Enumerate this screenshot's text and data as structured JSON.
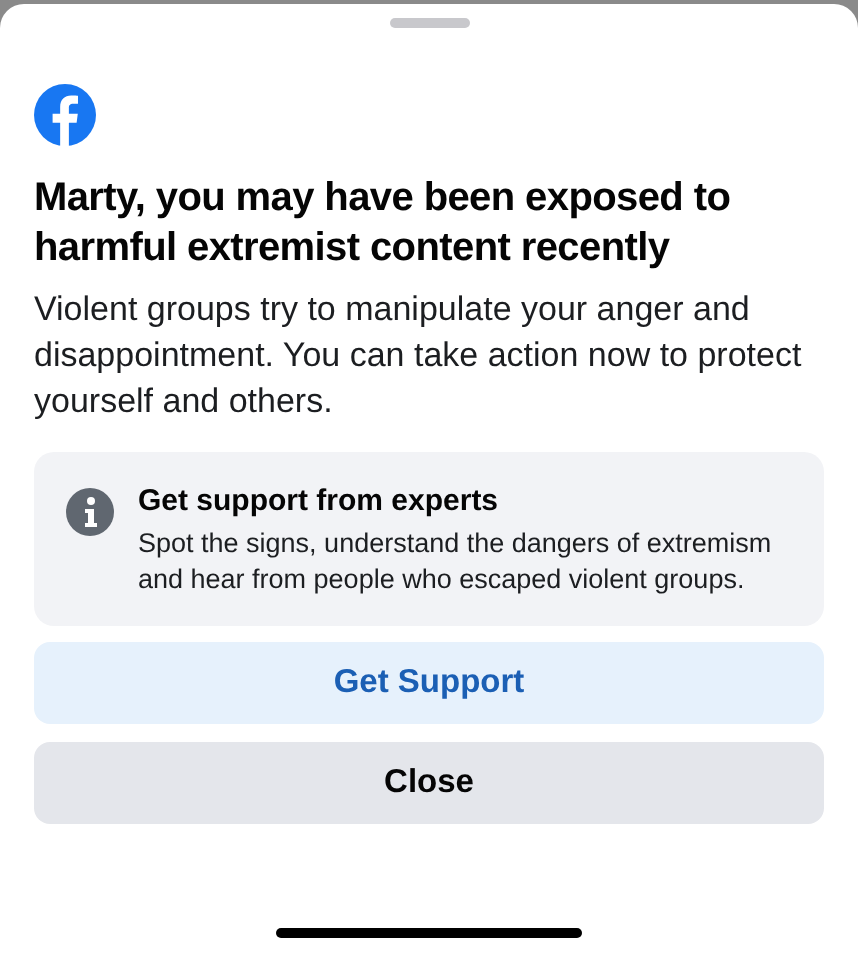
{
  "sheet": {
    "title": "Marty, you may have been exposed to harmful extremist content recently",
    "body": "Violent groups try to manipulate your anger and disappointment. You can take action now to protect yourself and others.",
    "info_card": {
      "title": "Get support from experts",
      "text": "Spot the signs, understand the dangers of extremism and hear from people who escaped violent groups."
    },
    "buttons": [
      {
        "label": "Get Support",
        "kind": "primary"
      },
      {
        "label": "Close",
        "kind": "secondary"
      }
    ]
  }
}
